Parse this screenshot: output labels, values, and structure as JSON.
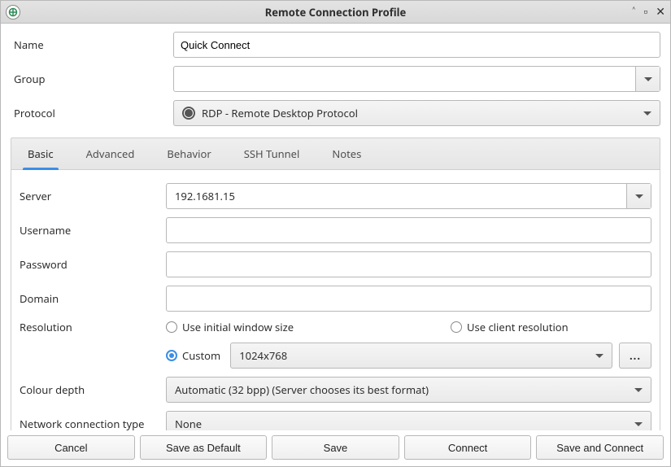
{
  "window": {
    "title": "Remote Connection Profile"
  },
  "top": {
    "name_label": "Name",
    "name_value": "Quick Connect",
    "group_label": "Group",
    "group_value": "",
    "protocol_label": "Protocol",
    "protocol_value": "RDP - Remote Desktop Protocol"
  },
  "tabs": {
    "t0": "Basic",
    "t1": "Advanced",
    "t2": "Behavior",
    "t3": "SSH Tunnel",
    "t4": "Notes"
  },
  "basic": {
    "server_label": "Server",
    "server_value": "192.1681.15",
    "username_label": "Username",
    "username_value": "",
    "password_label": "Password",
    "password_value": "",
    "domain_label": "Domain",
    "domain_value": "",
    "resolution_label": "Resolution",
    "res_initial": "Use initial window size",
    "res_client": "Use client resolution",
    "res_custom": "Custom",
    "res_custom_value": "1024x768",
    "more_label": "...",
    "colour_label": "Colour depth",
    "colour_value": "Automatic (32 bpp) (Server chooses its best format)",
    "net_label": "Network connection type",
    "net_value": "None"
  },
  "buttons": {
    "cancel": "Cancel",
    "save_default": "Save as Default",
    "save": "Save",
    "connect": "Connect",
    "save_connect": "Save and Connect"
  }
}
